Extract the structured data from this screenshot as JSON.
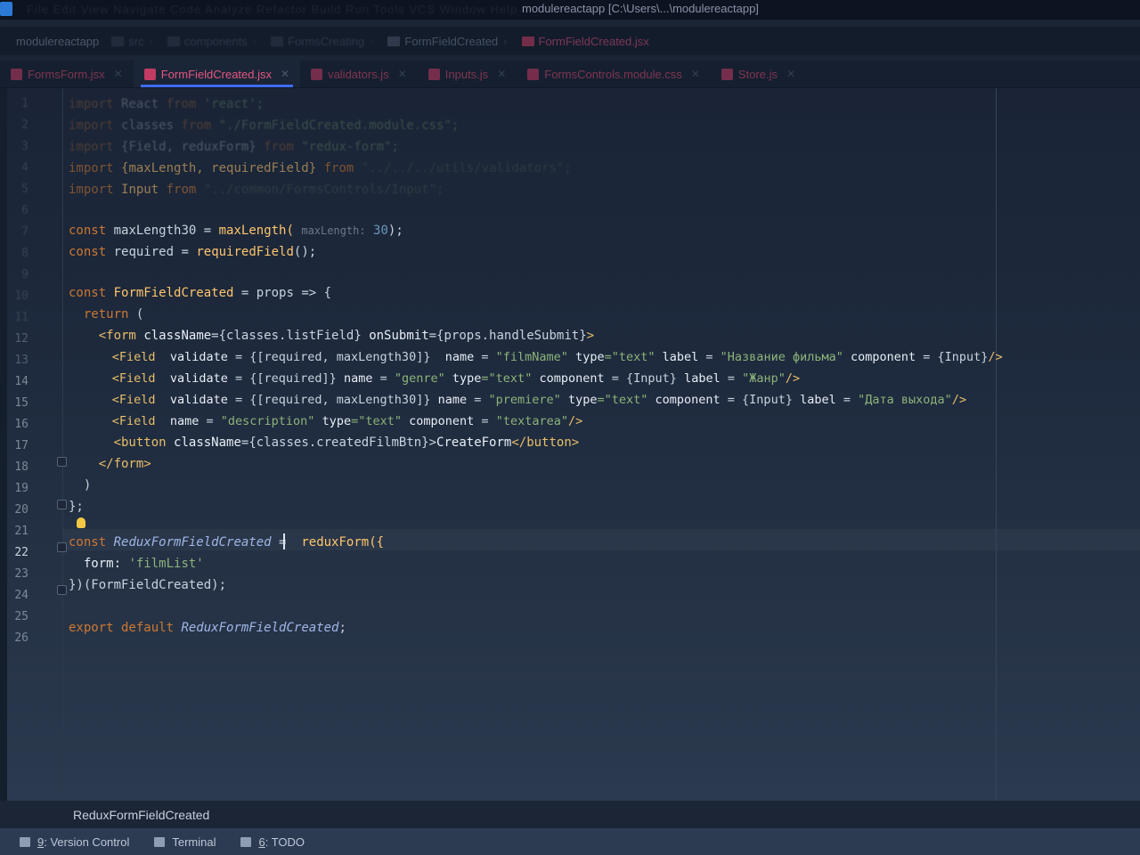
{
  "window": {
    "title": "modulereactapp [C:\\Users\\...\\modulereactapp]",
    "menus": "File  Edit  View  Navigate  Code  Analyze  Refactor  Build  Run  Tools  VCS  Window  Help"
  },
  "breadcrumbs": {
    "project": "modulereactapp",
    "items": [
      "src",
      "components",
      "FormsCreating",
      "FormFieldCreated",
      "FormFieldCreated.jsx"
    ]
  },
  "tabs": [
    {
      "label": "FormsForm.jsx",
      "active": false
    },
    {
      "label": "FormFieldCreated.jsx",
      "active": true
    },
    {
      "label": "validators.js",
      "active": false
    },
    {
      "label": "Inputs.js",
      "active": false
    },
    {
      "label": "FormsControls.module.css",
      "active": false
    },
    {
      "label": "Store.js",
      "active": false
    }
  ],
  "editor": {
    "current_line": 22,
    "line_numbers": [
      "1",
      "2",
      "3",
      "4",
      "5",
      "6",
      "7",
      "8",
      "9",
      "10",
      "11",
      "12",
      "13",
      "14",
      "15",
      "16",
      "17",
      "18",
      "19",
      "20",
      "21",
      "22",
      "23",
      "24",
      "25",
      "26"
    ],
    "code": {
      "l1_import": "import",
      "l1_name": "React",
      "l1_from": "from",
      "l1_src": "'react';",
      "l2_import": "import",
      "l2_name": "classes",
      "l2_from": "from",
      "l2_src": "\"./FormFieldCreated.module.css\";",
      "l3_import": "import",
      "l3_name": "{Field, reduxForm}",
      "l3_from": "from",
      "l3_src": "\"redux-form\";",
      "l4_import": "import",
      "l4_name": "{maxLength, requiredField}",
      "l4_from": "from",
      "l4_src": "\"../../../utils/validators\";",
      "l5_import": "import",
      "l5_name": "Input",
      "l5_from": "from",
      "l5_src": "\"../common/FormsControls/Input\";",
      "l7_const": "const",
      "l7_name": "maxLength30",
      "l7_eq": "=",
      "l7_fn": "maxLength(",
      "l7_hint": "maxLength:",
      "l7_num": "30",
      "l7_end": ");",
      "l8_const": "const",
      "l8_name": "required",
      "l8_eq": "=",
      "l8_fn": "requiredField",
      "l8_end": "();",
      "l10_const": "const",
      "l10_name": "FormFieldCreated",
      "l10_rest": "= props => {",
      "l11_return": "return",
      "l11_rest": "(",
      "l12_tag": "<form",
      "l12_attr": "className",
      "l12_val": "={classes.listField}",
      "l12_attr2": "onSubmit",
      "l12_val2": "={props.handleSubmit}",
      "l12_end": ">",
      "l13_tag": "<Field",
      "l13_a1": "validate",
      "l13_v1": "= {[required, maxLength30]}",
      "l13_a2": "name",
      "l13_v2": "= ",
      "l13_s2": "\"filmName\"",
      "l13_a3": "type",
      "l13_s3": "=\"text\"",
      "l13_a4": "label",
      "l13_v4": "= ",
      "l13_s4": "\"Название фильма\"",
      "l13_a5": "component",
      "l13_v5": "= {Input}",
      "l13_end": "/>",
      "l14_tag": "<Field",
      "l14_a1": "validate",
      "l14_v1": "= {[required]}",
      "l14_a2": "name",
      "l14_v2": "= ",
      "l14_s2": "\"genre\"",
      "l14_a3": "type",
      "l14_s3": "=\"text\"",
      "l14_a4": "component",
      "l14_v4": "= {Input}",
      "l14_a5": "label",
      "l14_v5": "= ",
      "l14_s5": "\"Жанр\"",
      "l14_end": "/>",
      "l15_tag": "<Field",
      "l15_a1": "validate",
      "l15_v1": "= {[required, maxLength30]}",
      "l15_a2": "name",
      "l15_v2": "= ",
      "l15_s2": "\"premiere\"",
      "l15_a3": "type",
      "l15_s3": "=\"text\"",
      "l15_a4": "component",
      "l15_v4": "= {Input}",
      "l15_a5": "label",
      "l15_v5": "= ",
      "l15_s5": "\"Дата выхода\"",
      "l15_end": "/>",
      "l16_tag": "<Field",
      "l16_a1": "name",
      "l16_v1": "= ",
      "l16_s1": "\"description\"",
      "l16_a2": "type",
      "l16_s2": "=\"text\"",
      "l16_a3": "component",
      "l16_v3": "= ",
      "l16_s3": "\"textarea\"",
      "l16_end": "/>",
      "l17_tag": "<button",
      "l17_attr": "className",
      "l17_val": "={classes.createdFilmBtn}>",
      "l17_text": "CreateForm",
      "l17_close": "</button>",
      "l18_tag": "</form>",
      "l19": ")",
      "l20": "};",
      "l22_const": "const",
      "l22_name": "ReduxFormFieldCreated",
      "l22_eq": "=",
      "l22_fn": "reduxForm({",
      "l23_key": "form:",
      "l23_val": "'filmList'",
      "l24": "})(FormFieldCreated);",
      "l26_export": "export default",
      "l26_name": "ReduxFormFieldCreated",
      "l26_end": ";"
    }
  },
  "code_breadcrumb": "ReduxFormFieldCreated",
  "toolwindows": [
    {
      "num": "9",
      "label": ": Version Control"
    },
    {
      "num": "",
      "label": "Terminal"
    },
    {
      "num": "6",
      "label": ": TODO"
    }
  ]
}
